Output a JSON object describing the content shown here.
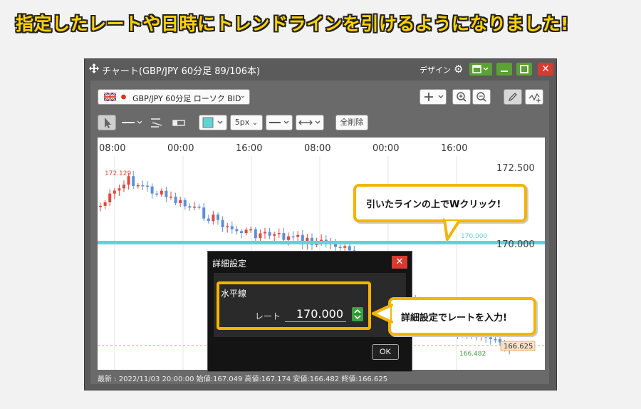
{
  "headline": "指定したレートや日時にトレンドラインを引けるようになりました!",
  "window": {
    "title": "チャート(GBP/JPY 60分足 89/106本)",
    "design_label": "デザイン",
    "close_glyph": "✕"
  },
  "toolbar": {
    "symbol_label": "GBP/JPY 60分足 ローソク BID",
    "width_value": "5px",
    "clear_label": "全削除",
    "line_color": "#5fd3d6"
  },
  "chart": {
    "time_labels": [
      "08:00",
      "00:00",
      "16:00",
      "08:00",
      "00:00",
      "16:00"
    ],
    "price_labels": [
      "172.500",
      "170.000",
      "166.625"
    ],
    "high_label": "172.129",
    "low_label": "166.482",
    "line_label": "170.000",
    "colors": {
      "up": "#e5463a",
      "down": "#5b8fe0",
      "line": "#5fd3d6",
      "current": "#f0a050"
    }
  },
  "status": {
    "text": "最新 : 2022/11/03 20:00:00 始値:167.049 高値:167.174 安値:166.482 終値:166.625"
  },
  "dialog": {
    "title": "詳細設定",
    "close_glyph": "✕",
    "kind": "水平線",
    "rate_label": "レート",
    "rate_value": "170.000",
    "ok_label": "OK"
  },
  "callouts": {
    "double_click": "引いたラインの上でWクリック!",
    "enter_rate": "詳細設定でレートを入力!"
  }
}
